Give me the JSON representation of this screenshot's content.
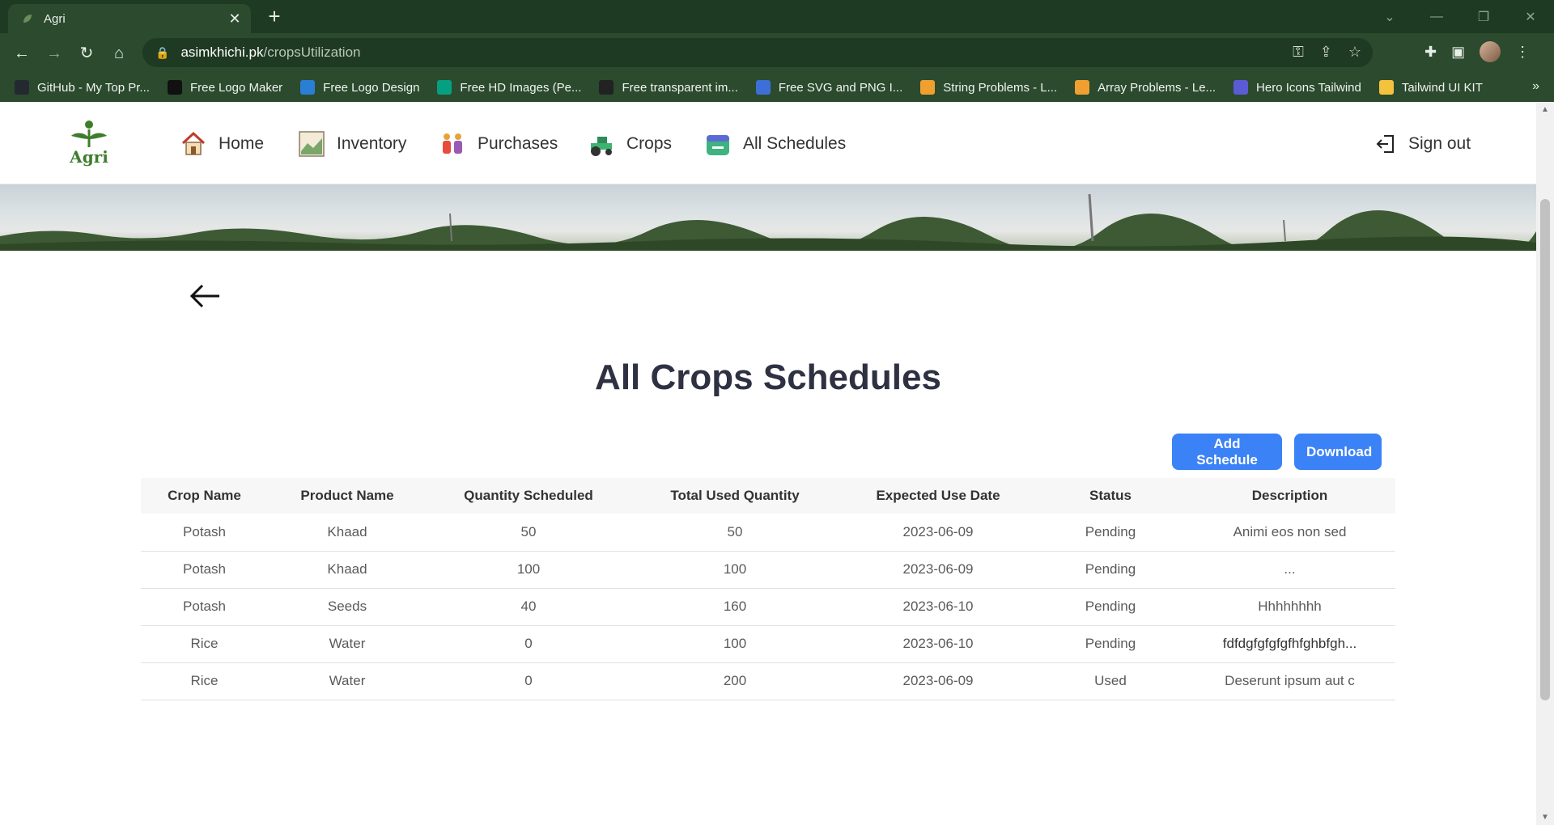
{
  "browser": {
    "tab_title": "Agri",
    "url_host": "asimkhichi.pk",
    "url_path": "/cropsUtilization",
    "bookmarks": [
      {
        "label": "GitHub - My Top Pr...",
        "color": "#24292f"
      },
      {
        "label": "Free Logo Maker",
        "color": "#111111"
      },
      {
        "label": "Free Logo Design",
        "color": "#2a7fd4"
      },
      {
        "label": "Free HD Images (Pe...",
        "color": "#05a081"
      },
      {
        "label": "Free transparent im...",
        "color": "#222222"
      },
      {
        "label": "Free SVG and PNG I...",
        "color": "#3d6fd8"
      },
      {
        "label": "String Problems - L...",
        "color": "#f0a030"
      },
      {
        "label": "Array Problems - Le...",
        "color": "#f0a030"
      },
      {
        "label": "Hero Icons Tailwind",
        "color": "#5b5bd6"
      },
      {
        "label": "Tailwind UI KIT",
        "color": "#f4c23c"
      }
    ]
  },
  "nav": {
    "logo_text": "Agri",
    "items": [
      {
        "label": "Home",
        "icon": "house-icon"
      },
      {
        "label": "Inventory",
        "icon": "chart-icon"
      },
      {
        "label": "Purchases",
        "icon": "people-icon"
      },
      {
        "label": "Crops",
        "icon": "tractor-icon"
      },
      {
        "label": "All Schedules",
        "icon": "calendar-icon"
      }
    ],
    "signout_label": "Sign out"
  },
  "main": {
    "title": "All Crops Schedules",
    "add_schedule_label": "Add Schedule",
    "download_label": "Download"
  },
  "table": {
    "headers": [
      "Crop Name",
      "Product Name",
      "Quantity Scheduled",
      "Total Used Quantity",
      "Expected Use Date",
      "Status",
      "Description"
    ],
    "rows": [
      [
        "Potash",
        "Khaad",
        "50",
        "50",
        "2023-06-09",
        "Pending",
        "Animi eos non sed"
      ],
      [
        "Potash",
        "Khaad",
        "100",
        "100",
        "2023-06-09",
        "Pending",
        "..."
      ],
      [
        "Potash",
        "Seeds",
        "40",
        "160",
        "2023-06-10",
        "Pending",
        "Hhhhhhhh"
      ],
      [
        "Rice",
        "Water",
        "0",
        "100",
        "2023-06-10",
        "Pending",
        "fdfdgfgfgfgfhfghbfgh..."
      ],
      [
        "Rice",
        "Water",
        "0",
        "200",
        "2023-06-09",
        "Used",
        "Deserunt ipsum aut c"
      ]
    ]
  },
  "colors": {
    "accent": "#3b82f6",
    "brand_green": "#3f7d2d",
    "chrome_dark": "#1f3a22",
    "chrome": "#2b4a2e"
  }
}
